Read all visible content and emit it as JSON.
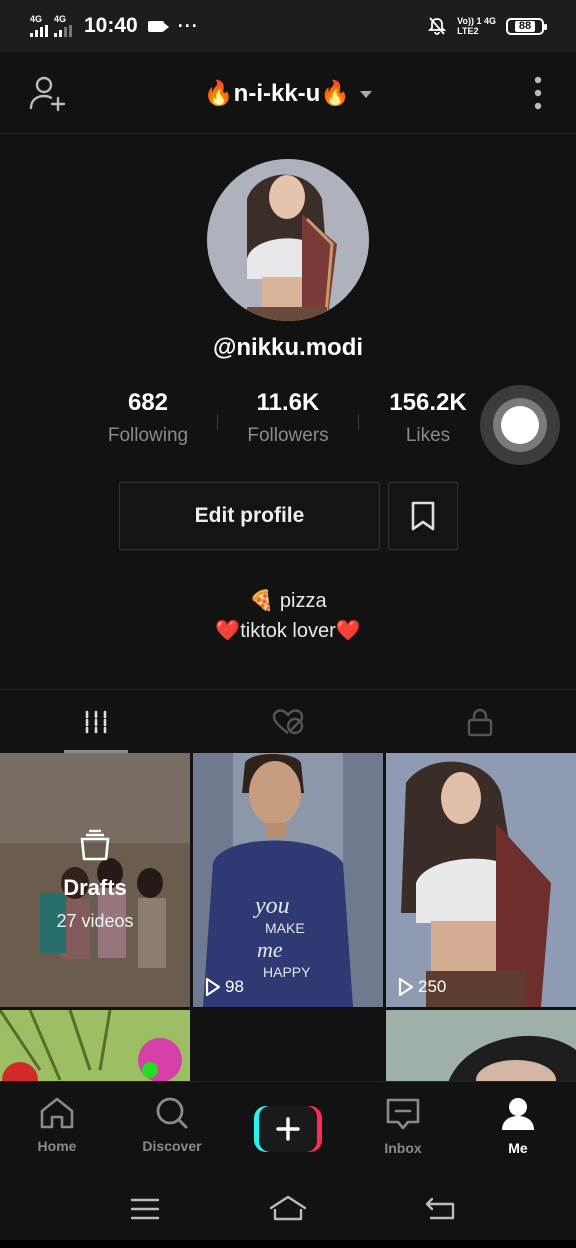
{
  "status_bar": {
    "sim1": "4G",
    "sim2": "4G",
    "time": "10:40",
    "more": "···",
    "net_line1": "Vo)) 1 4G",
    "net_line2": "LTE2",
    "battery": "88"
  },
  "header": {
    "title": "🔥n-i-kk-u🔥"
  },
  "profile": {
    "handle": "@nikku.modi",
    "stats": [
      {
        "value": "682",
        "label": "Following"
      },
      {
        "value": "11.6K",
        "label": "Followers"
      },
      {
        "value": "156.2K",
        "label": "Likes"
      }
    ],
    "edit_label": "Edit profile",
    "bio_line1": "🍕 pizza",
    "bio_line2": "❤️tiktok lover❤️"
  },
  "tabs": [
    "videos-tab",
    "liked-tab",
    "private-tab"
  ],
  "grid": {
    "drafts_title": "Drafts",
    "drafts_count": "27 videos",
    "video1_views": "98",
    "video2_views": "250"
  },
  "bottom_nav": {
    "home": "Home",
    "discover": "Discover",
    "inbox": "Inbox",
    "me": "Me"
  },
  "colors": {
    "background": "#121212",
    "accent_cyan": "#25f4ee",
    "accent_red": "#fe2c55"
  }
}
